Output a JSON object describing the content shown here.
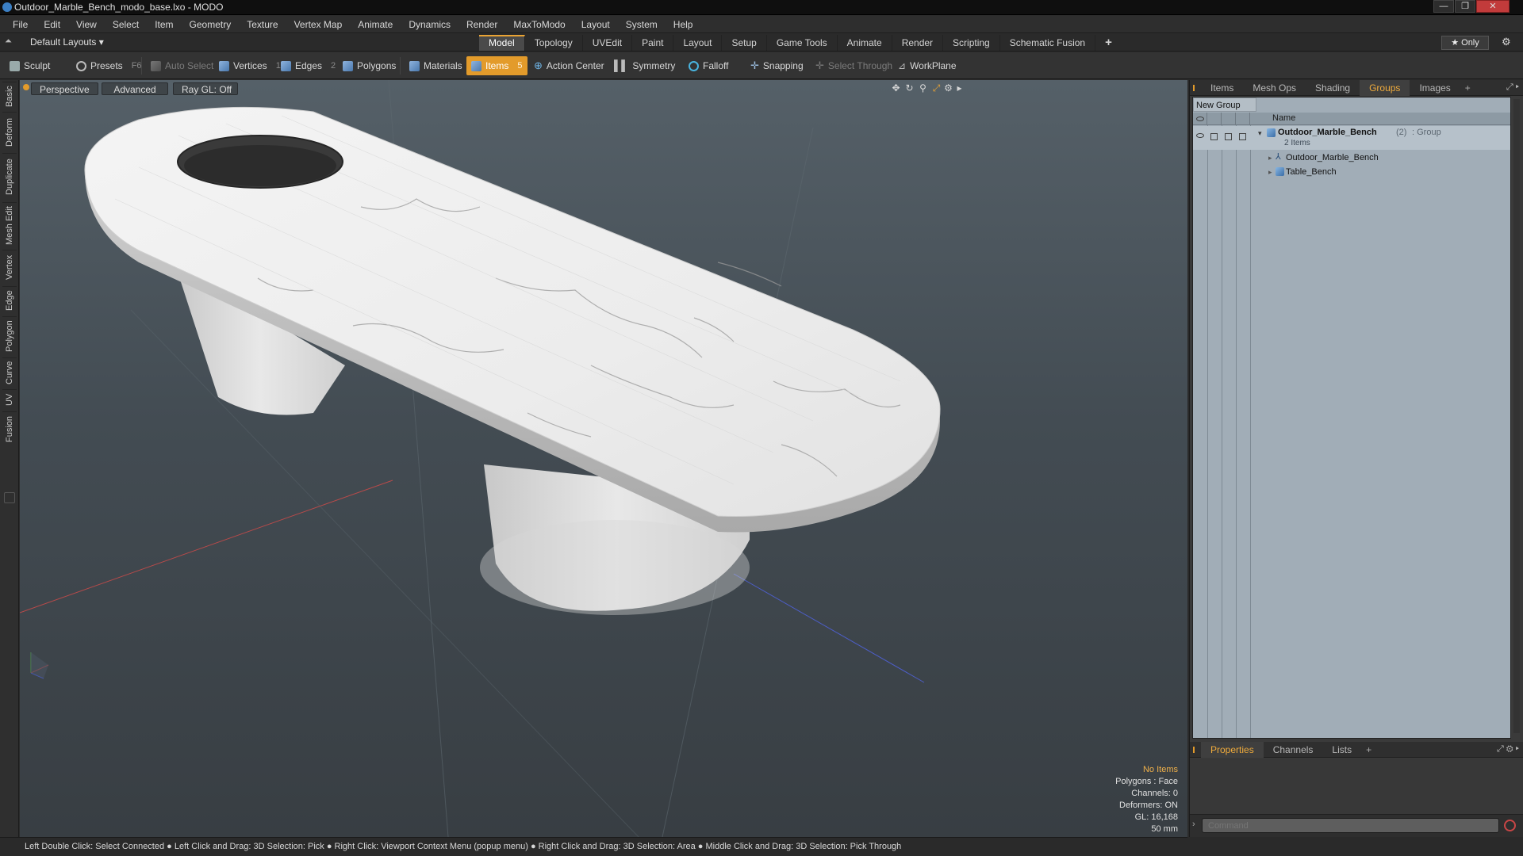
{
  "window": {
    "title": "Outdoor_Marble_Bench_modo_base.lxo - MODO",
    "controls": [
      "—",
      "❐",
      "✕"
    ]
  },
  "menu": [
    "File",
    "Edit",
    "View",
    "Select",
    "Item",
    "Geometry",
    "Texture",
    "Vertex Map",
    "Animate",
    "Dynamics",
    "Render",
    "MaxToModo",
    "Layout",
    "System",
    "Help"
  ],
  "layouts": {
    "selector": "Default Layouts ▾",
    "tabs": [
      "Model",
      "Topology",
      "UVEdit",
      "Paint",
      "Layout",
      "Setup",
      "Game Tools",
      "Animate",
      "Render",
      "Scripting",
      "Schematic Fusion"
    ],
    "active_tab": "Model",
    "add": "+",
    "only_label": "★  Only",
    "gear": "⚙"
  },
  "toolbar": {
    "sculpt": "Sculpt",
    "presets": "Presets",
    "presets_key": "F6",
    "auto_select": "Auto Select",
    "vertices": "Vertices",
    "vertices_key": "1",
    "edges": "Edges",
    "edges_key": "2",
    "polygons": "Polygons",
    "materials": "Materials",
    "items": "Items",
    "items_key": "5",
    "action_center": "Action Center",
    "symmetry": "Symmetry",
    "falloff": "Falloff",
    "snapping": "Snapping",
    "select_through": "Select Through",
    "workplane": "WorkPlane"
  },
  "left_tabs": [
    "Basic",
    "Deform",
    "Duplicate",
    "Mesh Edit",
    "Vertex",
    "Edge",
    "Polygon",
    "Curve",
    "UV",
    "Fusion"
  ],
  "viewport": {
    "view_mode": "Perspective",
    "shading": "Advanced",
    "raygl": "Ray GL: Off",
    "hud": {
      "selection": "No Items",
      "polygons": "Polygons : Face",
      "channels": "Channels: 0",
      "deformers": "Deformers: ON",
      "gl": "GL: 16,168",
      "scale": "50 mm"
    }
  },
  "right_panel": {
    "tabs": [
      "Items",
      "Mesh Ops",
      "Shading",
      "Groups",
      "Images"
    ],
    "active_tab": "Groups",
    "add": "+",
    "new_group": "New Group",
    "column_name": "Name",
    "group": {
      "name": "Outdoor_Marble_Bench",
      "count": "(2)",
      "type": ": Group",
      "items_label": "2 Items",
      "children": [
        "Outdoor_Marble_Bench",
        "Table_Bench"
      ]
    },
    "bottom_tabs": [
      "Properties",
      "Channels",
      "Lists"
    ],
    "bottom_active": "Properties",
    "command_placeholder": "Command"
  },
  "status": "Left Double Click: Select Connected ● Left Click and Drag: 3D Selection: Pick ● Right Click: Viewport Context Menu (popup menu) ● Right Click and Drag: 3D Selection: Area ● Middle Click and Drag: 3D Selection: Pick Through",
  "colors": {
    "accent": "#e39b2b",
    "active_tab_text": "#efab3c",
    "hud_highlight": "#f0b04a"
  }
}
